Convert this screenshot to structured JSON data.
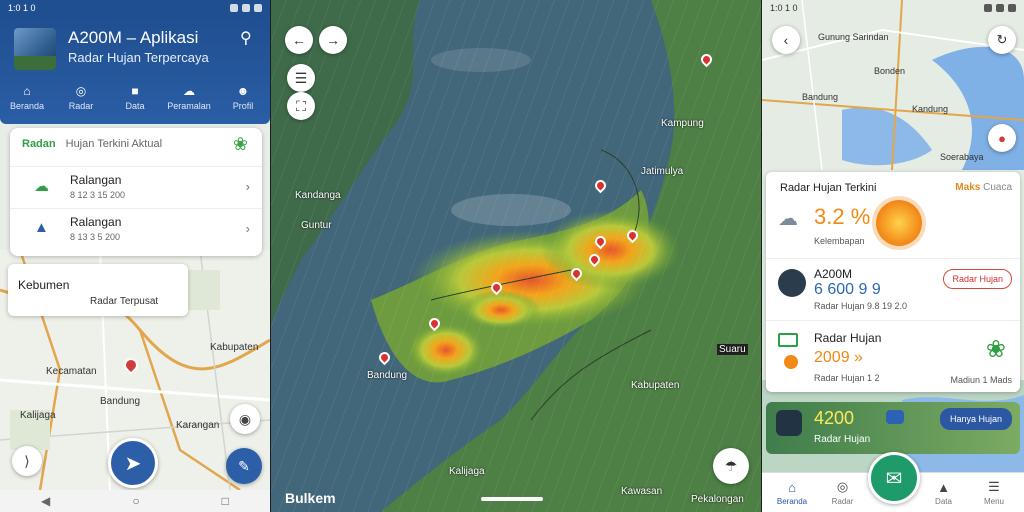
{
  "panel1": {
    "status": {
      "time": "1:0 1 0"
    },
    "header": {
      "title": "A200M – Aplikasi",
      "subtitle": "Radar Hujan Terpercaya"
    },
    "tabs": [
      {
        "label": "Beranda",
        "icon": "home-icon"
      },
      {
        "label": "Radar",
        "icon": "radar-icon"
      },
      {
        "label": "Data",
        "icon": "data-icon"
      },
      {
        "label": "Peramalan",
        "icon": "forecast-icon"
      },
      {
        "label": "Profil",
        "icon": "profile-icon"
      }
    ],
    "list": {
      "head": "Radan",
      "head_sub": "Hujan Terkini Aktual",
      "rows": [
        {
          "title": "Ralangan",
          "sub": "8 12 3 15 200"
        },
        {
          "title": "Ralangan",
          "sub": "8 13 3 5 200"
        }
      ]
    },
    "location_card": {
      "title": "Kebumen",
      "sub": "Radar Terpusat"
    },
    "map_labels": [
      "Kabupaten",
      "Kecamatan",
      "Bandung",
      "Karangan",
      "Kalijaga"
    ]
  },
  "panel2": {
    "labels": [
      "Kampung",
      "Kandanga",
      "Guntur",
      "Jatimulya",
      "Kabupaten",
      "Bandung",
      "Kalijaga",
      "Kawasan",
      "Pekalongan",
      "Suaru"
    ],
    "watermark": "Bulkem"
  },
  "panel3": {
    "status": {
      "time": "1:0 1 0"
    },
    "map_labels": [
      "Gunung Sarindan",
      "Bonden",
      "Bandung",
      "Kandung",
      "Soerabaya"
    ],
    "main_card": {
      "heading": "Radar Hujan Terkini",
      "tag_orange": "Maks",
      "tag_gray": "Cuaca",
      "value": "3.2 %",
      "caption": "Kelembapan",
      "rows": [
        {
          "title": "A200M",
          "value": "6 600 9 9",
          "sub": "Radar Hujan 9.8 19 2.0",
          "pill": "Radar Hujan"
        },
        {
          "title": "Radar Hujan",
          "value": "2009 »",
          "sub": "Radar Hujan 1 2",
          "loc": "Madiun 1 Mads"
        }
      ]
    },
    "strip": {
      "value": "4200",
      "sub": "Radar Hujan",
      "button": "Hanya Hujan"
    },
    "bottom_nav": [
      {
        "label": "Beranda",
        "icon": "home-icon",
        "active": true
      },
      {
        "label": "Radar",
        "icon": "radar-icon",
        "active": false
      },
      {
        "label": "",
        "icon": "",
        "active": false
      },
      {
        "label": "Data",
        "icon": "data-icon",
        "active": false
      },
      {
        "label": "Menu",
        "icon": "menu-icon",
        "active": false
      }
    ]
  }
}
